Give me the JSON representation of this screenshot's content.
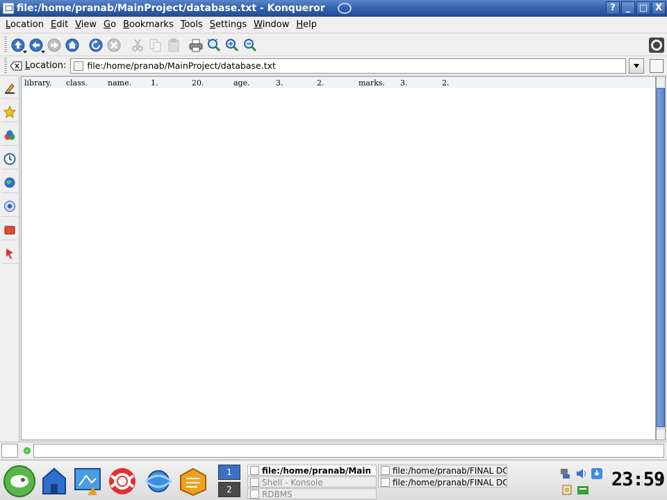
{
  "window": {
    "title": "file:/home/pranab/MainProject/database.txt - Konqueror",
    "controls": [
      "?",
      "_",
      "□",
      "X"
    ]
  },
  "menubar": [
    {
      "first": "L",
      "rest": "ocation"
    },
    {
      "first": "E",
      "rest": "dit"
    },
    {
      "first": "V",
      "rest": "iew"
    },
    {
      "first": "G",
      "rest": "o"
    },
    {
      "first": "B",
      "rest": "ookmarks"
    },
    {
      "first": "T",
      "rest": "ools"
    },
    {
      "first": "S",
      "rest": "ettings"
    },
    {
      "first": "W",
      "rest": "indow"
    },
    {
      "first": "H",
      "rest": "elp"
    }
  ],
  "toolbar": {
    "icons": [
      "up-icon",
      "back-icon",
      "forward-icon",
      "home-icon",
      "reload-icon",
      "stop-icon",
      "cut-icon",
      "copy-icon",
      "paste-icon",
      "print-icon",
      "zoom-icon",
      "zoom-in-icon",
      "zoom-out-icon"
    ]
  },
  "location": {
    "label_first": "L",
    "label_rest": "ocation:",
    "value": "file:/home/pranab/MainProject/database.txt"
  },
  "sidebar": {
    "icons": [
      "sidebar-config-icon",
      "bookmarks-icon",
      "services-icon",
      "history-icon",
      "network-icon",
      "root-folder-icon",
      "home-folder-icon",
      "media-icon"
    ]
  },
  "document": {
    "line": [
      "library.",
      "class.",
      "name.",
      "1.",
      "20.",
      "age.",
      "3.",
      "2.",
      "marks.",
      "3.",
      "2."
    ]
  },
  "taskbar": {
    "desktops": [
      "1",
      "2"
    ],
    "tasks": [
      "file:/home/pranab/Main",
      "Shell - Konsole",
      "RDBMS",
      "file:/home/pranab/FINAL DO",
      "file:/home/pranab/FINAL DO"
    ],
    "clock": "23:59"
  }
}
